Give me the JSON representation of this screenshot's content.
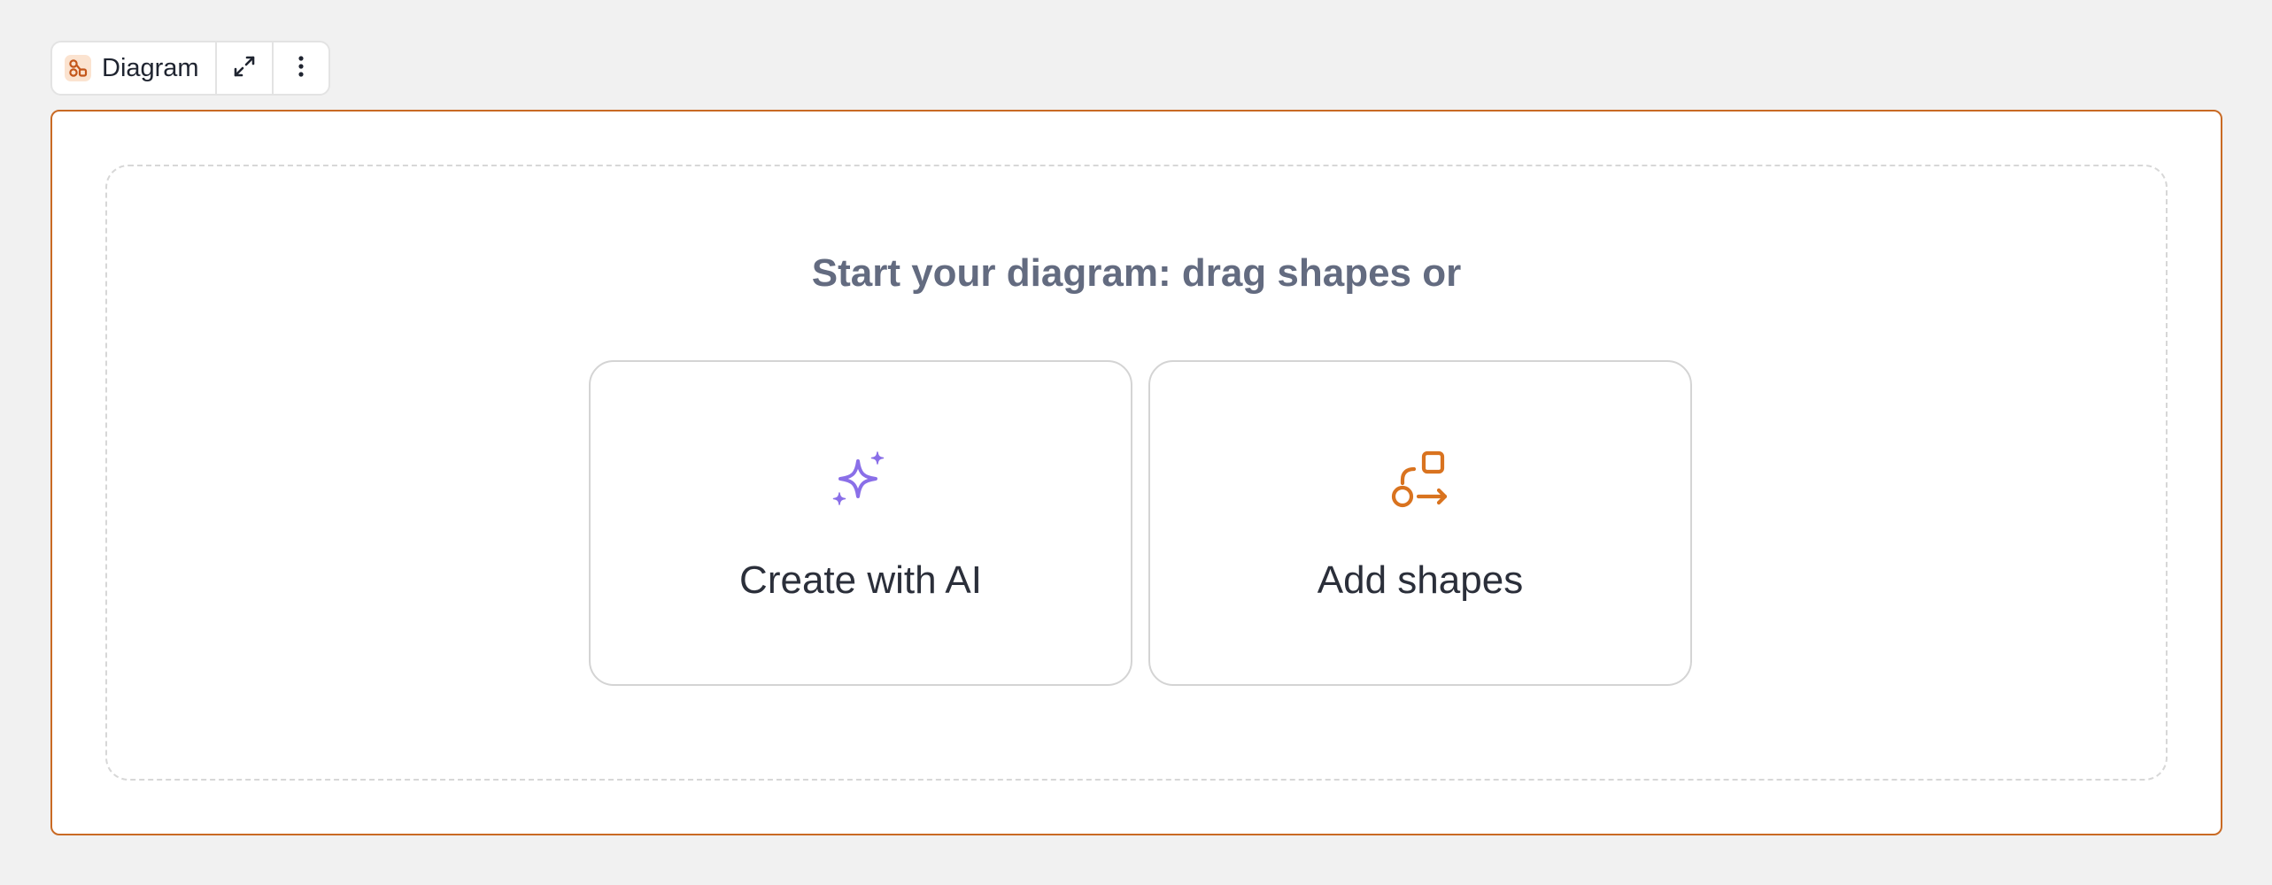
{
  "toolbar": {
    "title": "Diagram",
    "icons": {
      "diagram": "diagram-icon",
      "expand": "expand-icon",
      "more": "more-vertical-icon"
    }
  },
  "canvas": {
    "heading": "Start your diagram: drag shapes or",
    "cards": [
      {
        "label": "Create with AI",
        "icon": "sparkle-icon",
        "accent": "#8a6fe8"
      },
      {
        "label": "Add shapes",
        "icon": "shapes-icon",
        "accent": "#d9731f"
      }
    ]
  },
  "colors": {
    "frame_border": "#c96a24",
    "heading_text": "#636b80",
    "diagram_badge_bg": "#fbe3d0",
    "diagram_badge_icon": "#c4561a"
  }
}
